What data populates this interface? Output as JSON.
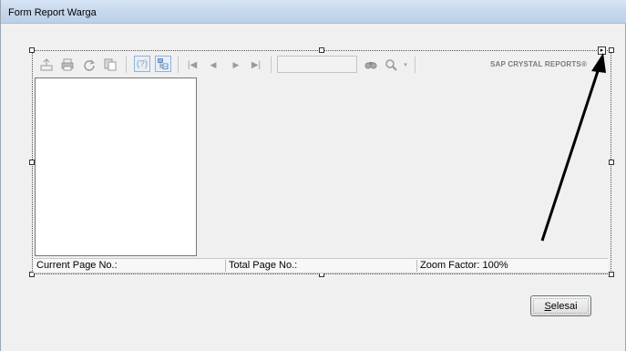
{
  "window": {
    "title": "Form Report Warga"
  },
  "toolbar": {
    "icons": [
      "export-icon",
      "print-icon",
      "refresh-icon",
      "copy-icon",
      "help-icon",
      "group-tree-icon",
      "first-page-icon",
      "previous-page-icon",
      "next-page-icon",
      "last-page-icon",
      "find-icon",
      "zoom-icon"
    ],
    "page_input_value": "",
    "brand": "SAP CRYSTAL REPORTS®",
    "help_glyph": "(?)"
  },
  "statusbar": {
    "current_page": "Current Page No.:",
    "total_page": "Total Page No.:",
    "zoom_factor": "Zoom Factor: 100%"
  },
  "button": {
    "finish_first": "S",
    "finish_rest": "elesai"
  }
}
